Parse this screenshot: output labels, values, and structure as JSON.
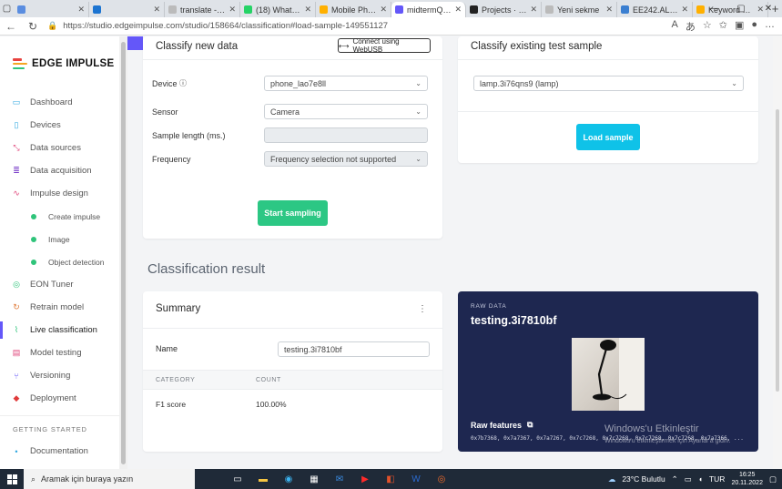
{
  "browser": {
    "tabs": [
      {
        "label": "",
        "color": "#5a8de0"
      },
      {
        "label": "",
        "color": "#1c74d1"
      },
      {
        "label": "translate - Goo",
        "color": "#bbbbbb"
      },
      {
        "label": "(18) WhatsApp",
        "color": "#25d366"
      },
      {
        "label": "Mobile Phone",
        "color": "#ffb000"
      },
      {
        "label": "midtermQ1.4 -",
        "color": "#6457f9",
        "active": true
      },
      {
        "label": "Projects · midt",
        "color": "#222222"
      },
      {
        "label": "Yeni sekme",
        "color": "#bbbbbb"
      },
      {
        "label": "EE242.ALL: Mi",
        "color": "#3b7fd1"
      },
      {
        "label": "Keyword spotti",
        "color": "#ffb000"
      }
    ],
    "url": "https://studio.edgeimpulse.com/studio/158664/classification#load-sample-149551127"
  },
  "sidebar": {
    "brand": "EDGE IMPULSE",
    "items": [
      {
        "label": "Dashboard",
        "icon": "monitor-icon",
        "color": "#2ea7e0"
      },
      {
        "label": "Devices",
        "icon": "device-icon",
        "color": "#2ea7e0"
      },
      {
        "label": "Data sources",
        "icon": "data-sources-icon",
        "color": "#e0457b"
      },
      {
        "label": "Data acquisition",
        "icon": "database-icon",
        "color": "#7a3fc9"
      },
      {
        "label": "Impulse design",
        "icon": "pulse-icon",
        "color": "#e0457b"
      }
    ],
    "subitems": [
      "Create impulse",
      "Image",
      "Object detection"
    ],
    "items2": [
      {
        "label": "EON Tuner",
        "icon": "tuner-icon",
        "color": "#2fc47a"
      },
      {
        "label": "Retrain model",
        "icon": "retrain-icon",
        "color": "#e07b3a"
      },
      {
        "label": "Live classification",
        "icon": "live-classification-icon",
        "color": "#2fc47a",
        "active": true
      },
      {
        "label": "Model testing",
        "icon": "model-testing-icon",
        "color": "#e0457b"
      },
      {
        "label": "Versioning",
        "icon": "versioning-icon",
        "color": "#6457f9"
      },
      {
        "label": "Deployment",
        "icon": "deployment-icon",
        "color": "#e03a3a"
      }
    ],
    "section_getting_started": "GETTING STARTED",
    "documentation": "Documentation"
  },
  "classify_new": {
    "title": "Classify new data",
    "webusb_button": "Connect using WebUSB",
    "device_label": "Device",
    "device_value": "phone_lao7e8ll",
    "sensor_label": "Sensor",
    "sensor_value": "Camera",
    "sample_length_label": "Sample length (ms.)",
    "sample_length_value": "",
    "frequency_label": "Frequency",
    "frequency_value": "Frequency selection not supported",
    "start_button": "Start sampling"
  },
  "classify_existing": {
    "title": "Classify existing test sample",
    "sample_value": "lamp.3i76qns9 (lamp)",
    "load_button": "Load sample"
  },
  "result": {
    "heading": "Classification result",
    "summary_title": "Summary",
    "name_label": "Name",
    "name_value": "testing.3i7810bf",
    "col_category": "CATEGORY",
    "col_count": "COUNT",
    "row_category": "F1 score",
    "row_count": "100.00%"
  },
  "raw": {
    "label": "RAW DATA",
    "title": "testing.3i7810bf",
    "features_label": "Raw features",
    "features": "0x7b7368, 0x7a7367, 0x7a7267, 0x7c7268, 0x7c7268, 0x7c7268, 0x7c7268, 0x7a7366, ..."
  },
  "watermark": {
    "line1": "Windows'u Etkinleştir",
    "line2": "Windows'u etkinleştirmek için Ayarlar'a gidin."
  },
  "taskbar": {
    "search_placeholder": "Aramak için buraya yazın",
    "weather": "23°C  Bulutlu",
    "lang": "TUR",
    "time": "16:25",
    "date": "20.11.2022"
  }
}
